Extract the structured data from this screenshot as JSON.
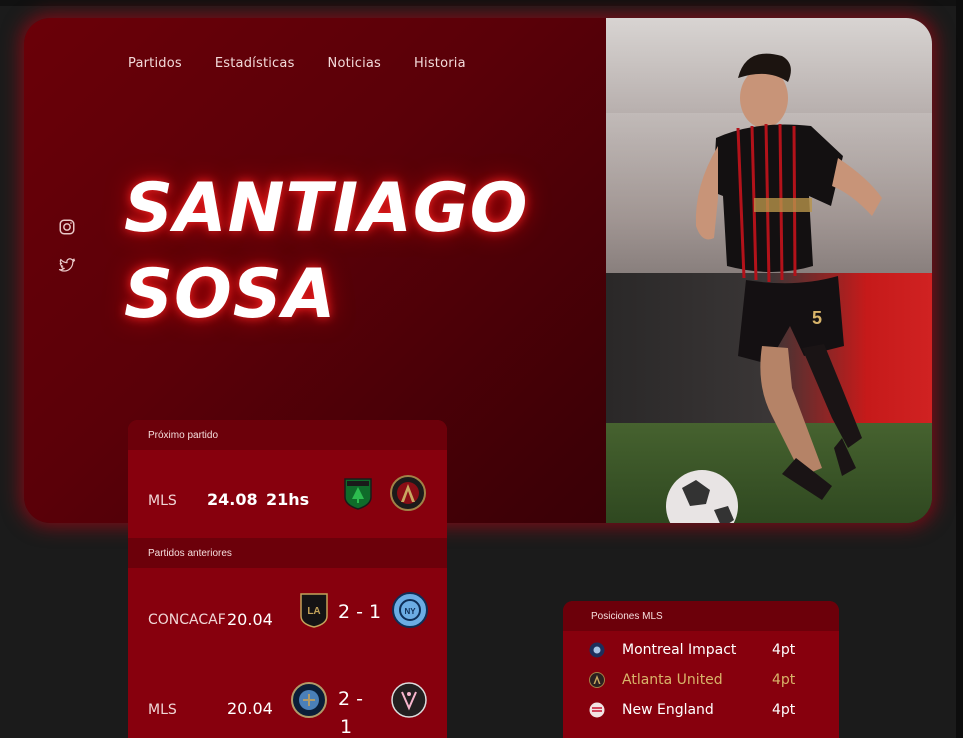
{
  "nav": {
    "items": [
      {
        "label": "Partidos"
      },
      {
        "label": "Estadísticas"
      },
      {
        "label": "Noticias"
      },
      {
        "label": "Historia"
      }
    ]
  },
  "social": {
    "icons": [
      "instagram-icon",
      "twitter-icon"
    ]
  },
  "player": {
    "first_name": "SANTIAGO",
    "last_name": "SOSA"
  },
  "next_match": {
    "header": "Próximo partido",
    "competition": "MLS",
    "date": "24.08",
    "time": "21hs",
    "home_crest": "austin-fc-crest",
    "away_crest": "atlanta-united-crest"
  },
  "previous_matches": {
    "header": "Partidos anteriores",
    "matches": [
      {
        "competition": "CONCACAF",
        "date": "20.04",
        "score": "2 - 1",
        "home_crest": "lafc-crest",
        "away_crest": "nycfc-crest"
      },
      {
        "competition": "MLS",
        "date": "20.04",
        "score_line1": "2 -",
        "score_line2": "1",
        "home_crest": "philadelphia-union-crest",
        "away_crest": "inter-miami-crest"
      }
    ]
  },
  "standings": {
    "header": "Posiciones MLS",
    "rows": [
      {
        "team": "Montreal Impact",
        "points": "4pt",
        "highlighted": false,
        "badge": "montreal-impact-badge"
      },
      {
        "team": "Atlanta United",
        "points": "4pt",
        "highlighted": true,
        "badge": "atlanta-united-badge"
      },
      {
        "team": "New England",
        "points": "4pt",
        "highlighted": false,
        "badge": "new-england-badge"
      }
    ]
  },
  "colors": {
    "accent": "#87000d",
    "highlight": "#d8b46a",
    "glow": "#ff2828"
  }
}
